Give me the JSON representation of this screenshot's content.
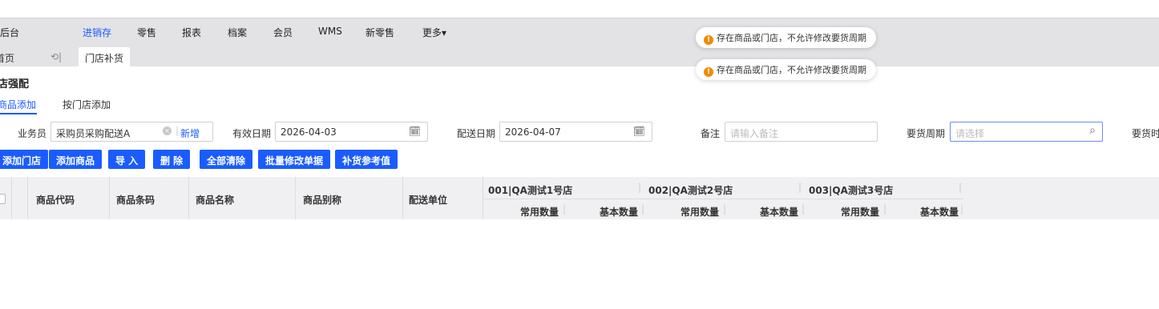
{
  "nav": {
    "brand": "后台",
    "items": [
      {
        "label": "进销存",
        "active": true
      },
      {
        "label": "零售",
        "active": false
      },
      {
        "label": "报表",
        "active": false
      },
      {
        "label": "档案",
        "active": false
      },
      {
        "label": "会员",
        "active": false
      },
      {
        "label": "WMS",
        "active": false
      },
      {
        "label": "新零售",
        "active": false
      },
      {
        "label": "更多▾",
        "active": false
      }
    ]
  },
  "tabbar": {
    "home": "首页",
    "back": "⟲|",
    "current_tab": "门店补货"
  },
  "toasts": [
    {
      "icon": "!",
      "text": "存在商品或门店，不允许修改要货周期"
    },
    {
      "icon": "!",
      "text": "存在商品或门店，不允许修改要货周期"
    }
  ],
  "page": {
    "title": "店强配",
    "subtabs": [
      {
        "label": "商品添加",
        "active": true
      },
      {
        "label": "按门店添加",
        "active": false
      }
    ]
  },
  "form": {
    "salesman_label": "业务员",
    "salesman_value": "采购员采购配送A",
    "clear_icon": "×",
    "add_new": "新增",
    "valid_date_label": "有效日期",
    "valid_date_value": "2026-04-03",
    "delivery_date_label": "配送日期",
    "delivery_date_value": "2026-04-07",
    "calendar_icon": "🗓",
    "remark_label": "备注",
    "remark_placeholder": "请输入备注",
    "cycle_label": "要货周期",
    "cycle_placeholder": "请选择",
    "search_icon": "⌕",
    "cycle_time_label": "要货时"
  },
  "toolbar": {
    "buttons": [
      "添加门店",
      "添加商品",
      "导 入",
      "删 除",
      "全部清除",
      "批量修改单据",
      "补货参考值"
    ]
  },
  "table": {
    "columns": [
      "商品代码",
      "商品条码",
      "商品名称",
      "商品别称",
      "配送单位"
    ],
    "stores": [
      "001|QA测试1号店",
      "002|QA测试2号店",
      "003|QA测试3号店"
    ],
    "sub_columns": [
      "常用数量",
      "基本数量"
    ]
  },
  "colors": {
    "accent": "#1a5cff",
    "nav_bg": "#e3e3e6",
    "warning": "#f08a00"
  }
}
